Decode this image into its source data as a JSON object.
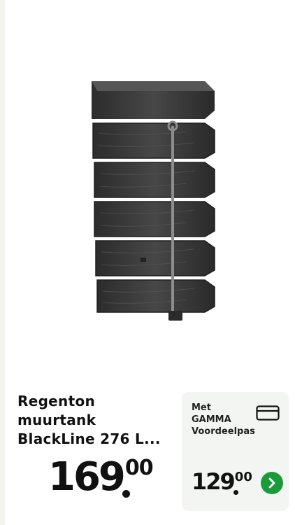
{
  "product": {
    "title_line1": "Regenton",
    "title_line2": "muurtank",
    "title_line3": "BlackLine 276 L...",
    "price_int": "169",
    "price_dec": "00"
  },
  "promo": {
    "label_line1": "Met",
    "label_line2": "GAMMA",
    "label_line3": "Voordeelpas",
    "price_int": "129",
    "price_dec": "00",
    "card_icon": "card-icon",
    "button_icon": "chevron-right-icon",
    "button_color": "#1b9a3c"
  },
  "image": {
    "subject": "black wall-mounted rain barrel with wood-grain texture",
    "color": "#3a3a3a"
  }
}
